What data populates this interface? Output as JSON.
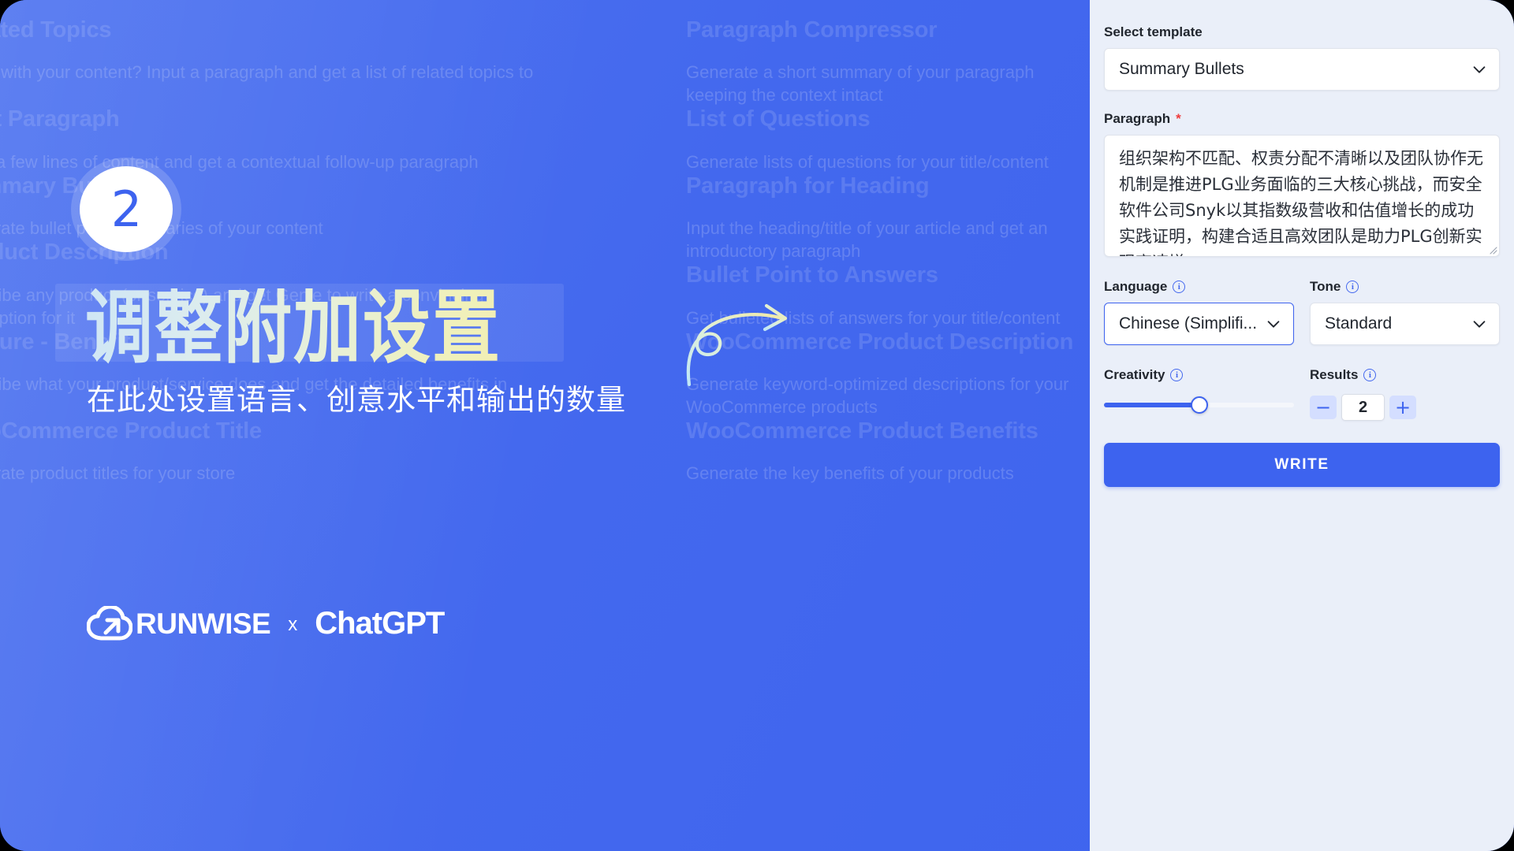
{
  "background": {
    "cards_left": [
      {
        "title": "Related Topics",
        "desc": "Stuck with your content? Input a paragraph and get a list of related topics to cover"
      },
      {
        "title": "Next Paragraph",
        "desc": "Input a few lines of content and get a contextual follow-up paragraph"
      },
      {
        "title": "Summary Bullets",
        "desc": "Generate bullet point summaries of your content"
      },
      {
        "title": "Product Description",
        "desc": "Describe any product (or service) and get Genie to write a convincing description for it"
      },
      {
        "title": "Feature - Benefit",
        "desc": "Describe what your product/service does and get the detailed benefits in return"
      },
      {
        "title": "WooCommerce Product Title",
        "desc": "Generate product titles for your store"
      }
    ],
    "cards_right": [
      {
        "title": "Paragraph Compressor",
        "desc": "Generate a short summary of your paragraph keeping the context intact"
      },
      {
        "title": "List of Questions",
        "desc": "Generate lists of questions for your title/content"
      },
      {
        "title": "Paragraph for Heading",
        "desc": "Input the heading/title of your article and get an introductory paragraph"
      },
      {
        "title": "Bullet Point to Answers",
        "desc": "Get bulleted lists of answers for your title/content"
      },
      {
        "title": "WooCommerce Product Description",
        "desc": "Generate keyword-optimized descriptions for your WooCommerce products"
      },
      {
        "title": "WooCommerce Product Benefits",
        "desc": "Generate the key benefits of your products"
      }
    ]
  },
  "hero": {
    "step_number": "2",
    "headline": "调整附加设置",
    "subtitle": "在此处设置语言、创意水平和输出的数量",
    "logo_primary": "RUNWISE",
    "logo_separator": "x",
    "logo_secondary": "ChatGPT"
  },
  "panel": {
    "template": {
      "label": "Select template",
      "value": "Summary Bullets"
    },
    "paragraph": {
      "label": "Paragraph",
      "required_marker": "*",
      "value": "组织架构不匹配、权责分配不清晰以及团队协作无机制是推进PLG业务面临的三大核心挑战，而安全软件公司Snyk以其指数级营收和估值增长的成功实践证明，构建合适且高效团队是助力PLG创新实现高速增"
    },
    "language": {
      "label": "Language",
      "value": "Chinese (Simplifi..."
    },
    "tone": {
      "label": "Tone",
      "value": "Standard"
    },
    "creativity": {
      "label": "Creativity",
      "percent": 50
    },
    "results": {
      "label": "Results",
      "value": "2",
      "decrement_label": "−",
      "increment_label": "+"
    },
    "write_button": "WRITE",
    "accent_color": "#3d63ef",
    "panel_bg": "#eaeff9"
  }
}
